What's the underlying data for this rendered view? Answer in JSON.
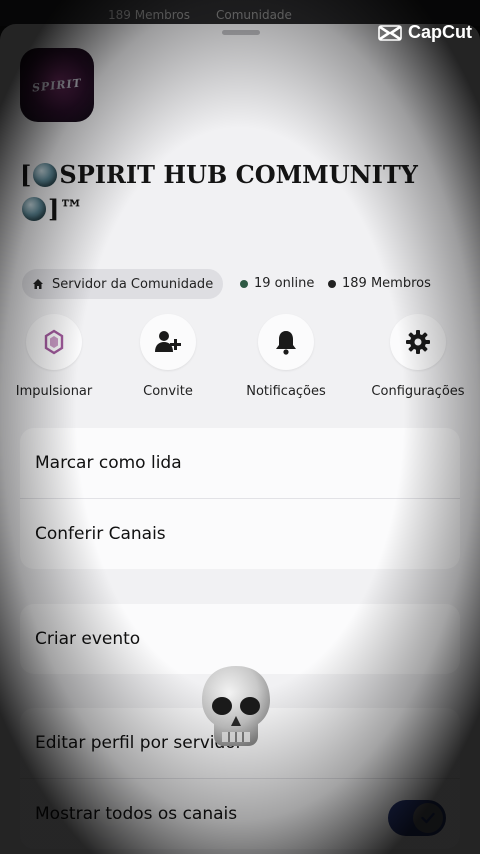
{
  "topbar": {
    "members_text": "189 Membros",
    "community_text": "Comunidade"
  },
  "watermark": {
    "text": "CapCut"
  },
  "server": {
    "logo_text": "SPIRIT",
    "title_open": "[",
    "title_name": "SPIRIT HUB COMMUNITY",
    "title_close": "]™",
    "badge_label": "Servidor da Comunidade",
    "online": "19 online",
    "members": "189 Membros"
  },
  "actions": [
    {
      "label": "Impulsionar",
      "icon": "boost-icon"
    },
    {
      "label": "Convite",
      "icon": "add-user-icon"
    },
    {
      "label": "Notificações",
      "icon": "bell-icon"
    },
    {
      "label": "Configurações",
      "icon": "gear-icon"
    }
  ],
  "menu": {
    "group1": [
      "Marcar como lida",
      "Conferir Canais"
    ],
    "group2": [
      "Criar evento"
    ],
    "group3": [
      "Editar perfil por servidor",
      "Mostrar todos os canais"
    ]
  },
  "toggle": {
    "show_all_channels": true
  },
  "colors": {
    "online_dot": "#2f5a44",
    "members_dot": "#222222",
    "toggle_on": "#2a3a7a",
    "boost": "#a05a9c"
  },
  "overlay": {
    "emoji": "skull"
  }
}
